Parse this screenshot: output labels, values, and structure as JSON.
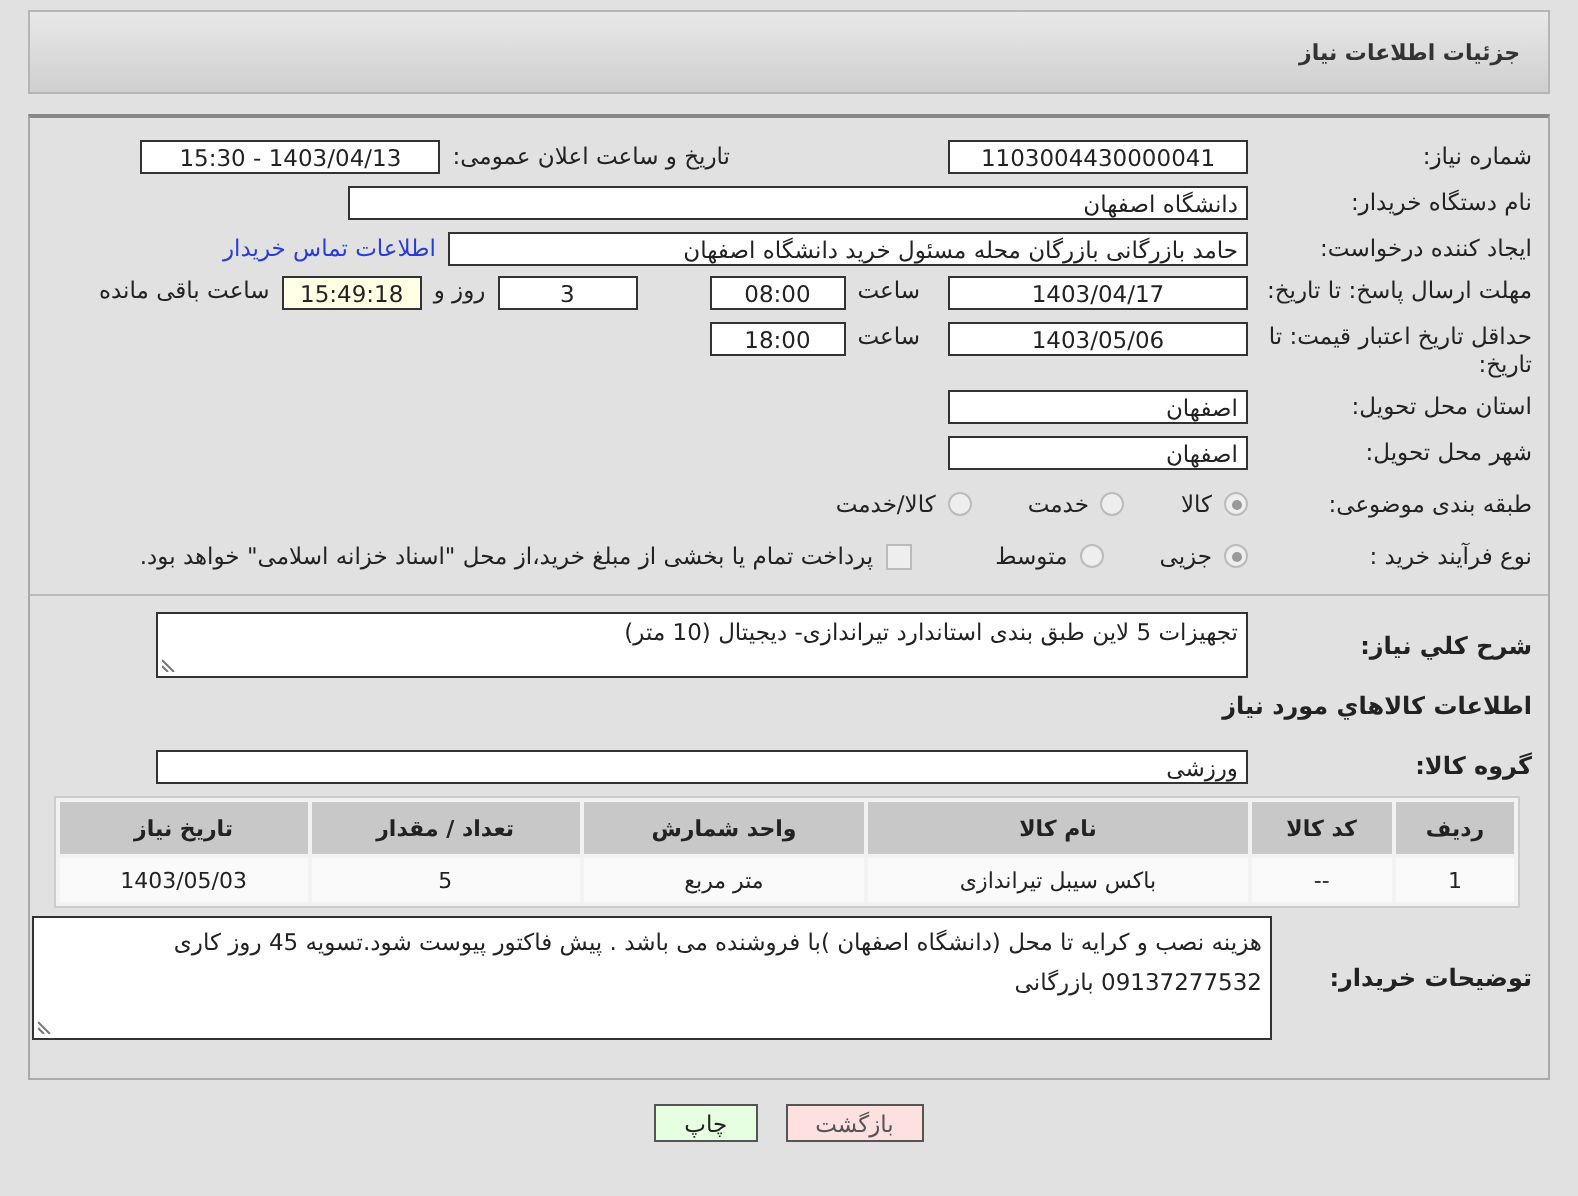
{
  "header": {
    "title": "جزئیات اطلاعات نیاز"
  },
  "need_number": {
    "label": "شماره نیاز:",
    "value": "1103004430000041"
  },
  "announce": {
    "label": "تاریخ و ساعت اعلان عمومی:",
    "value": "1403/04/13 - 15:30"
  },
  "buyer": {
    "label": "نام دستگاه خریدار:",
    "value": "دانشگاه اصفهان"
  },
  "creator": {
    "label": "ایجاد کننده درخواست:",
    "value": "حامد بازرگانی بازرگان محله مسئول خرید دانشگاه اصفهان",
    "link": "اطلاعات تماس خریدار"
  },
  "deadline": {
    "label": "مهلت ارسال پاسخ: تا تاریخ:",
    "date": "1403/04/17",
    "time_label": "ساعت",
    "time": "08:00",
    "days": "3",
    "days_label": "روز و",
    "remaining": "15:49:18",
    "remaining_label": "ساعت باقی مانده"
  },
  "validity": {
    "label": "حداقل تاریخ اعتبار قیمت: تا تاریخ:",
    "date": "1403/05/06",
    "time_label": "ساعت",
    "time": "18:00"
  },
  "province": {
    "label": "استان محل تحویل:",
    "value": "اصفهان"
  },
  "city": {
    "label": "شهر محل تحویل:",
    "value": "اصفهان"
  },
  "category": {
    "label": "طبقه بندی موضوعی:",
    "options": [
      {
        "label": "کالا",
        "selected": true
      },
      {
        "label": "خدمت",
        "selected": false
      },
      {
        "label": "کالا/خدمت",
        "selected": false
      }
    ]
  },
  "process": {
    "label": "نوع فرآیند خرید :",
    "options": [
      {
        "label": "جزیی",
        "selected": true
      },
      {
        "label": "متوسط",
        "selected": false
      }
    ],
    "treasury": {
      "label": "پرداخت تمام یا بخشی از مبلغ خرید،از محل \"اسناد خزانه اسلامی\" خواهد بود.",
      "checked": false
    }
  },
  "description": {
    "label": "شرح کلي نياز:",
    "value": "تجهیزات 5 لاین طبق بندی استاندارد تیراندازی- دیجیتال (10 متر)"
  },
  "goods_title": "اطلاعات کالاهاي مورد نياز",
  "goods_group": {
    "label": "گروه کالا:",
    "value": "ورزشی"
  },
  "table": {
    "columns": [
      "ردیف",
      "کد کالا",
      "نام کالا",
      "واحد شمارش",
      "تعداد / مقدار",
      "تاریخ نیاز"
    ],
    "rows": [
      [
        "1",
        "--",
        "باکس سیبل تیراندازی",
        "متر مربع",
        "5",
        "1403/05/03"
      ]
    ]
  },
  "buyer_notes": {
    "label": "توضیحات خریدار:",
    "lines": [
      "هزینه نصب و کرایه تا محل (دانشگاه اصفهان )با فروشنده می باشد . پیش فاکتور پیوست شود.تسویه 45 روز کاری",
      "09137277532 بازرگانی"
    ]
  },
  "buttons": [
    {
      "label": "بازگشت",
      "kind": "back"
    },
    {
      "label": "چاپ",
      "kind": "print"
    }
  ]
}
